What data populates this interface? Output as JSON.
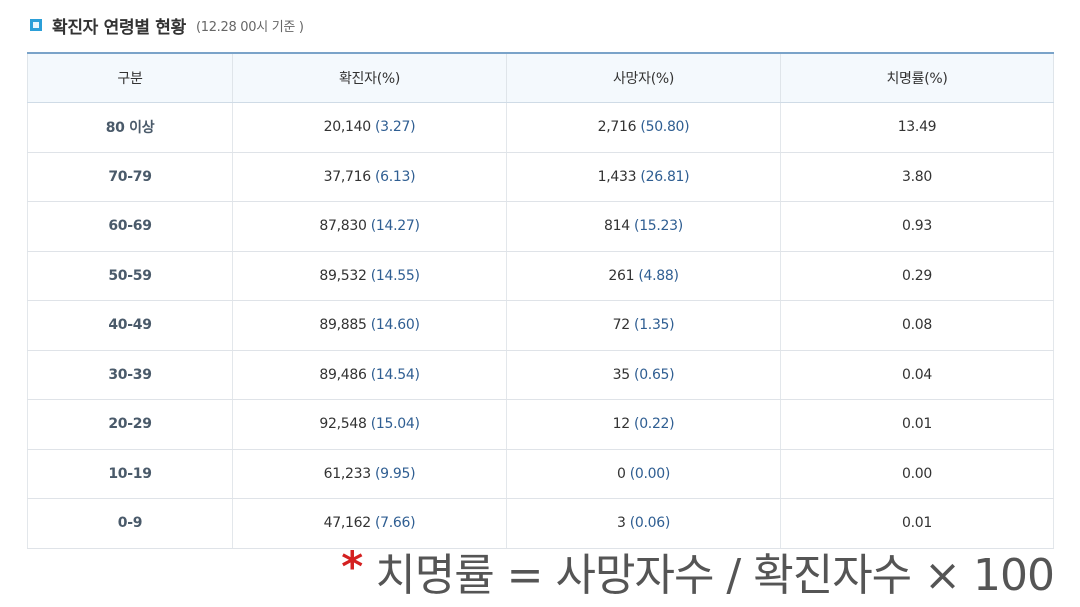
{
  "header": {
    "title": "확진자 연령별 현황",
    "subtitle": "(12.28 00시 기준 )"
  },
  "table": {
    "columns": [
      "구분",
      "확진자(%)",
      "사망자(%)",
      "치명률(%)"
    ],
    "rows": [
      {
        "age": "80 이상",
        "confirmed": "20,140",
        "confirmed_pct": "(3.27)",
        "deaths": "2,716",
        "deaths_pct": "(50.80)",
        "fatality": "13.49"
      },
      {
        "age": "70-79",
        "confirmed": "37,716",
        "confirmed_pct": "(6.13)",
        "deaths": "1,433",
        "deaths_pct": "(26.81)",
        "fatality": "3.80"
      },
      {
        "age": "60-69",
        "confirmed": "87,830",
        "confirmed_pct": "(14.27)",
        "deaths": "814",
        "deaths_pct": "(15.23)",
        "fatality": "0.93"
      },
      {
        "age": "50-59",
        "confirmed": "89,532",
        "confirmed_pct": "(14.55)",
        "deaths": "261",
        "deaths_pct": "(4.88)",
        "fatality": "0.29"
      },
      {
        "age": "40-49",
        "confirmed": "89,885",
        "confirmed_pct": "(14.60)",
        "deaths": "72",
        "deaths_pct": "(1.35)",
        "fatality": "0.08"
      },
      {
        "age": "30-39",
        "confirmed": "89,486",
        "confirmed_pct": "(14.54)",
        "deaths": "35",
        "deaths_pct": "(0.65)",
        "fatality": "0.04"
      },
      {
        "age": "20-29",
        "confirmed": "92,548",
        "confirmed_pct": "(15.04)",
        "deaths": "12",
        "deaths_pct": "(0.22)",
        "fatality": "0.01"
      },
      {
        "age": "10-19",
        "confirmed": "61,233",
        "confirmed_pct": "(9.95)",
        "deaths": "0",
        "deaths_pct": "(0.00)",
        "fatality": "0.00"
      },
      {
        "age": "0-9",
        "confirmed": "47,162",
        "confirmed_pct": "(7.66)",
        "deaths": "3",
        "deaths_pct": "(0.06)",
        "fatality": "0.01"
      }
    ]
  },
  "footnote": {
    "star": "*",
    "formula": "치명률 = 사망자수 / 확진자수 × 100"
  },
  "colors": {
    "accent": "#2b9fd8",
    "value_blue": "#2f5e92",
    "star_red": "#d42020"
  },
  "icons": {
    "title_marker": "square-bullet-icon"
  }
}
